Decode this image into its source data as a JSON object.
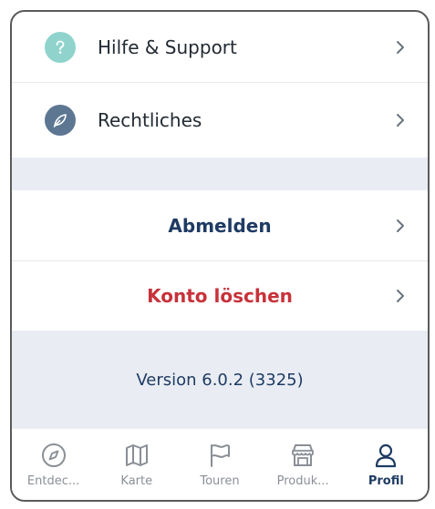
{
  "menu": {
    "help_label": "Hilfe & Support",
    "legal_label": "Rechtliches",
    "logout_label": "Abmelden",
    "delete_label": "Konto löschen"
  },
  "version": {
    "text": "Version 6.0.2 (3325)"
  },
  "tabbar": {
    "tabs": [
      {
        "label": "Entdec...",
        "icon": "compass-icon",
        "active": false
      },
      {
        "label": "Karte",
        "icon": "map-icon",
        "active": false
      },
      {
        "label": "Touren",
        "icon": "flag-icon",
        "active": false
      },
      {
        "label": "Produk...",
        "icon": "store-icon",
        "active": false
      },
      {
        "label": "Profil",
        "icon": "person-icon",
        "active": true
      }
    ]
  },
  "colors": {
    "help_icon_bg": "#8fd3cc",
    "legal_icon_bg": "#5d7692",
    "primary_navy": "#1f3b63",
    "danger_red": "#c8323a",
    "section_gray": "#e9edf3"
  }
}
